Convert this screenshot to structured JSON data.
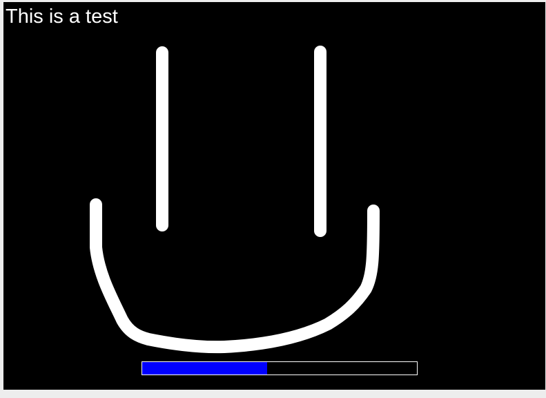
{
  "canvas": {
    "caption": "This is a test",
    "background_color": "#000000",
    "stroke_color": "#ffffff"
  },
  "progress": {
    "value": 0.455,
    "fill_color": "#0000ff"
  }
}
